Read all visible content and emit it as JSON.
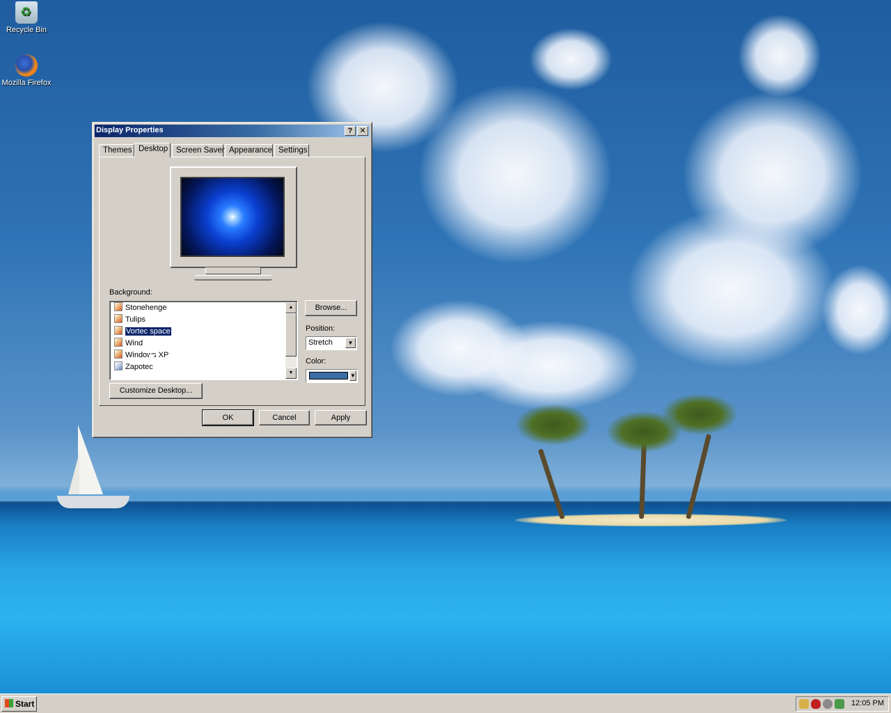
{
  "desktop": {
    "icons": [
      {
        "label": "Recycle Bin",
        "icon": "recycle-bin-icon"
      },
      {
        "label": "Mozilla Firefox",
        "icon": "firefox-icon"
      }
    ]
  },
  "window": {
    "title": "Display Properties",
    "help_glyph": "?",
    "close_glyph": "✕",
    "tabs": [
      {
        "label": "Themes"
      },
      {
        "label": "Desktop",
        "active": true
      },
      {
        "label": "Screen Saver"
      },
      {
        "label": "Appearance"
      },
      {
        "label": "Settings"
      }
    ],
    "background_label": "Background:",
    "background_items": [
      {
        "label": "Stonehenge",
        "icon": "image-file-icon"
      },
      {
        "label": "Tulips",
        "icon": "image-file-icon"
      },
      {
        "label": "Vortec space",
        "icon": "image-file-icon",
        "selected": true
      },
      {
        "label": "Wind",
        "icon": "image-file-icon"
      },
      {
        "label": "Windows XP",
        "icon": "image-file-icon"
      },
      {
        "label": "Zapotec",
        "icon": "html-file-icon"
      }
    ],
    "browse_label": "Browse...",
    "position_label": "Position:",
    "position_value": "Stretch",
    "color_label": "Color:",
    "color_value": "#3a6ea5",
    "customize_label": "Customize Desktop...",
    "ok_label": "OK",
    "cancel_label": "Cancel",
    "apply_label": "Apply"
  },
  "taskbar": {
    "start_label": "Start",
    "clock": "12:05 PM",
    "tray_icons": [
      "security-icon",
      "shield-icon",
      "update-icon",
      "network-icon"
    ]
  },
  "colors": {
    "title_bar": "#0a246a",
    "selection": "#0a246a",
    "face": "#d4d0c8"
  }
}
